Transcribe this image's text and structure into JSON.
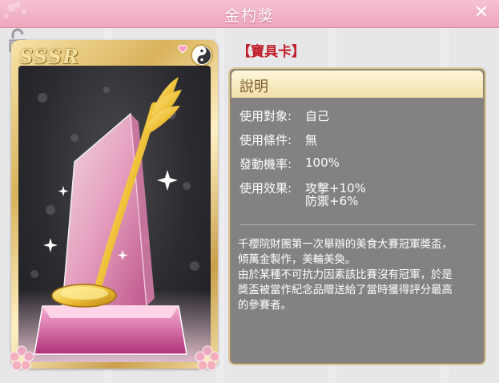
{
  "window": {
    "title": "金杓獎",
    "close_glyph": "✕"
  },
  "card": {
    "rarity": "SSSR",
    "attribute_icon": "yin-yang-icon",
    "item_icon": "golden-ladle-trophy"
  },
  "info": {
    "section_title": "【寶具卡】",
    "header": "說明",
    "rows": [
      {
        "label": "使用對象:",
        "value": "自己"
      },
      {
        "label": "使用條件:",
        "value": "無"
      },
      {
        "label": "發動機率:",
        "value": "100%"
      },
      {
        "label": "使用效果:",
        "value": "攻擊+10%",
        "value2": "防禦+6%"
      }
    ],
    "description": [
      "千櫻院財團第一次舉辦的美食大賽冠軍獎盃，",
      "傾萬金製作，美輪美奐。",
      "由於某種不可抗力因素該比賽沒有冠軍，於是",
      "獎盃被當作紀念品贈送給了當時獲得評分最高",
      "的參賽者。"
    ]
  },
  "colors": {
    "titlebar": "#eea6bd",
    "accent_red": "#c0202a",
    "panel_bg": "#848184",
    "gold": "#d9b35c"
  }
}
